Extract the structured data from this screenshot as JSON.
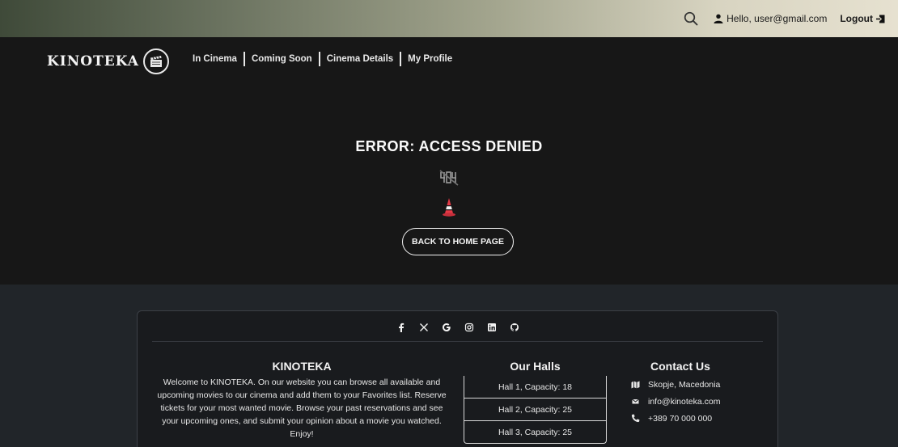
{
  "topbar": {
    "greeting": "Hello, user@gmail.com",
    "logout_label": "Logout"
  },
  "brand": {
    "name": "KINOTEKA"
  },
  "nav": {
    "items": [
      {
        "label": "In Cinema"
      },
      {
        "label": "Coming Soon"
      },
      {
        "label": "Cinema Details"
      },
      {
        "label": "My Profile"
      }
    ]
  },
  "error": {
    "title": "ERROR: ACCESS DENIED",
    "back_label": "BACK TO HOME PAGE"
  },
  "footer": {
    "social_icons": [
      "facebook-icon",
      "x-icon",
      "google-icon",
      "instagram-icon",
      "linkedin-icon",
      "github-icon"
    ],
    "about": {
      "title": "KINOTEKA",
      "text": "Welcome to KINOTEKA. On our website you can browse all available and upcoming movies to our cinema and add them to your Favorites list. Reserve tickets for your most wanted movie. Browse your past reservations and see your upcoming ones, and submit your opinion about a movie you watched. Enjoy!"
    },
    "halls": {
      "title": "Our Halls",
      "items": [
        {
          "label": "Hall 1, Capacity: 18"
        },
        {
          "label": "Hall 2, Capacity: 25"
        },
        {
          "label": "Hall 3, Capacity: 25"
        }
      ]
    },
    "contact": {
      "title": "Contact Us",
      "address": "Skopje, Macedonia",
      "email": "info@kinoteka.com",
      "phone": "+389 70 000 000"
    }
  },
  "colors": {
    "background": "#171717",
    "footer_background": "#212529",
    "accent_red": "#e63946"
  }
}
